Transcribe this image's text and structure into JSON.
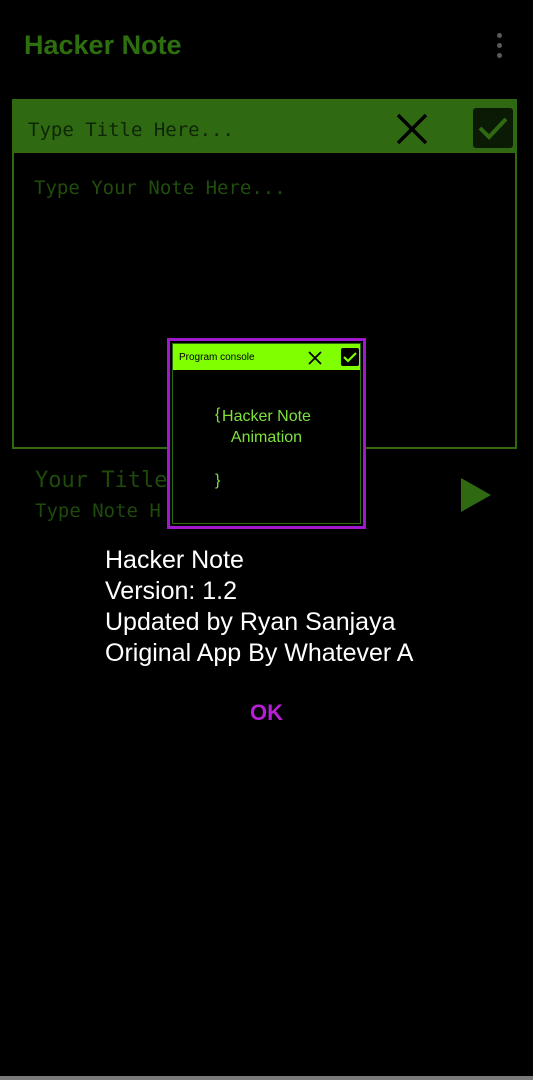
{
  "app": {
    "title": "Hacker Note"
  },
  "editor": {
    "title_placeholder": "Type Title Here...",
    "note_placeholder": "Type Your Note Here..."
  },
  "preview": {
    "title": "Your Title",
    "note": "Type Note H"
  },
  "console": {
    "title": "Program console",
    "brace_open": "{",
    "text_line1": "Hacker Note",
    "text_line2": "Animation",
    "brace_close": "}"
  },
  "about": {
    "line1": "Hacker Note",
    "line2": "Version: 1.2",
    "line3": "Updated by Ryan Sanjaya",
    "line4": "Original App By Whatever A"
  },
  "dialog": {
    "ok_label": "OK"
  },
  "colors": {
    "accent_green": "#2f6a12",
    "console_green": "#7fff00",
    "purple": "#a019cc"
  }
}
